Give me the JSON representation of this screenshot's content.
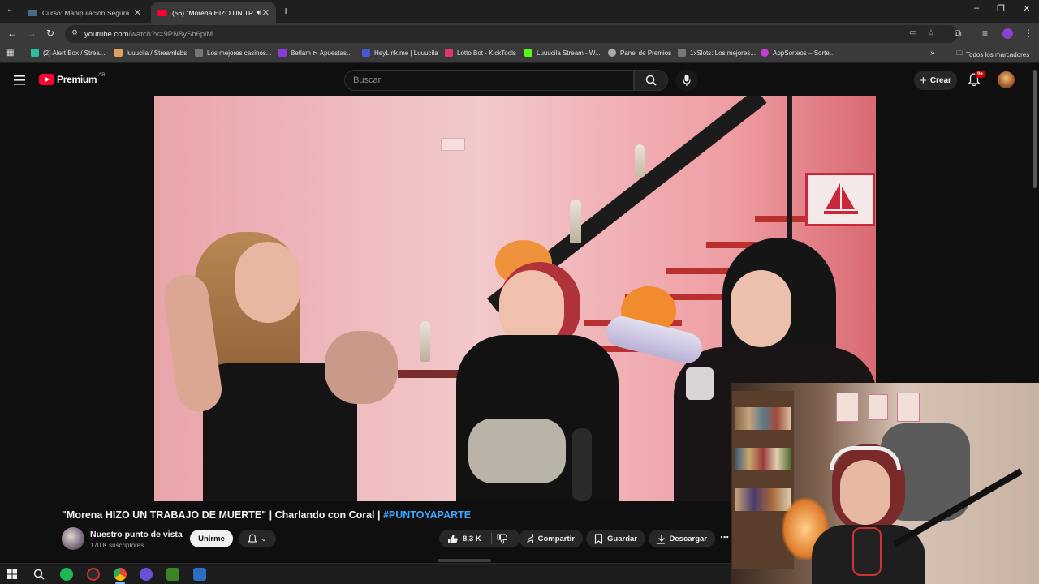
{
  "browser": {
    "tabs": [
      {
        "label": "Curso: Manipulación Segura de",
        "active": false
      },
      {
        "label": "(56) \"Morena HIZO UN TRA",
        "active": true
      }
    ],
    "url_host": "youtube.com",
    "url_path": "/watch?v=9PN8ySb6piM",
    "bookmarks": [
      {
        "label": "(2) Alert Box / Strea...",
        "color": "#27c0a6"
      },
      {
        "label": "luuucila / Streamlabs",
        "color": "#e0a060"
      },
      {
        "label": "Los mejores casinos...",
        "color": "#888888"
      },
      {
        "label": "Betlam ⊳ Apuestas...",
        "color": "#8a3cd9"
      },
      {
        "label": "HeyLink.me | Luuucila",
        "color": "#4a55d8"
      },
      {
        "label": "Lotto Bot - KickTools",
        "color": "#e0336f"
      },
      {
        "label": "Luuucila Stream - W...",
        "color": "#53fc18"
      },
      {
        "label": "Panel de Premios",
        "color": "#aaaaaa"
      },
      {
        "label": "1xSlots: Los mejores...",
        "color": "#888888"
      },
      {
        "label": "AppSorteos – Sorte...",
        "color": "#c23bd4"
      }
    ],
    "all_bookmarks": "Todos los marcadores"
  },
  "youtube": {
    "logo_text": "Premium",
    "region": "AR",
    "search_placeholder": "Buscar",
    "create_label": "Crear",
    "notif_badge": "9+",
    "video_title": "\"Morena HIZO UN TRABAJO DE MUERTE\" | Charlando con Coral | ",
    "video_hashtag": "#PUNTOYAPARTE",
    "channel_name": "Nuestro punto de vista",
    "channel_subs": "170 K suscriptores",
    "join_label": "Unirme",
    "like_count": "8,3 K",
    "share_label": "Compartir",
    "save_label": "Guardar",
    "download_label": "Descargar"
  },
  "colors": {
    "youtube_red": "#ff0033",
    "hashtag_blue": "#3ea6ff"
  },
  "icons": [
    "menu-icon",
    "search-icon",
    "mic-icon",
    "plus-icon",
    "bell-icon",
    "like-icon",
    "dislike-icon",
    "share-icon",
    "save-icon",
    "download-icon",
    "more-icon"
  ]
}
